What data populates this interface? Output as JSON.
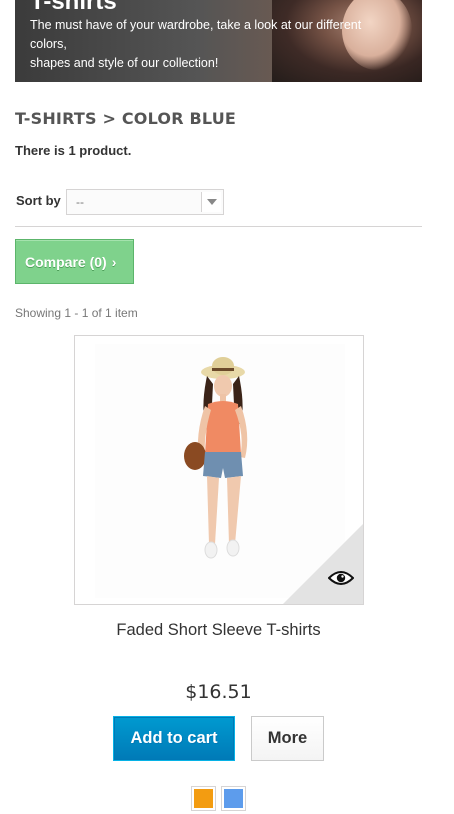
{
  "banner": {
    "title": "T-shirts",
    "description_line1": "The must have of your wardrobe, take a look at our different colors,",
    "description_line2": "shapes and style of our collection!"
  },
  "category": {
    "heading": "T-SHIRTS > COLOR BLUE",
    "product_count": "There is 1 product."
  },
  "sort": {
    "label": "Sort by",
    "selected": "--"
  },
  "compare": {
    "label": "Compare (0)",
    "chevron": "›"
  },
  "pagination": {
    "showing": "Showing 1 - 1 of 1 item"
  },
  "product": {
    "name": "Faded Short Sleeve T-shirts",
    "price": "$16.51",
    "add_to_cart": "Add to cart",
    "more": "More",
    "quick_view_icon": "eye-icon",
    "colors": [
      "#f39c11",
      "#5d9cec"
    ]
  }
}
